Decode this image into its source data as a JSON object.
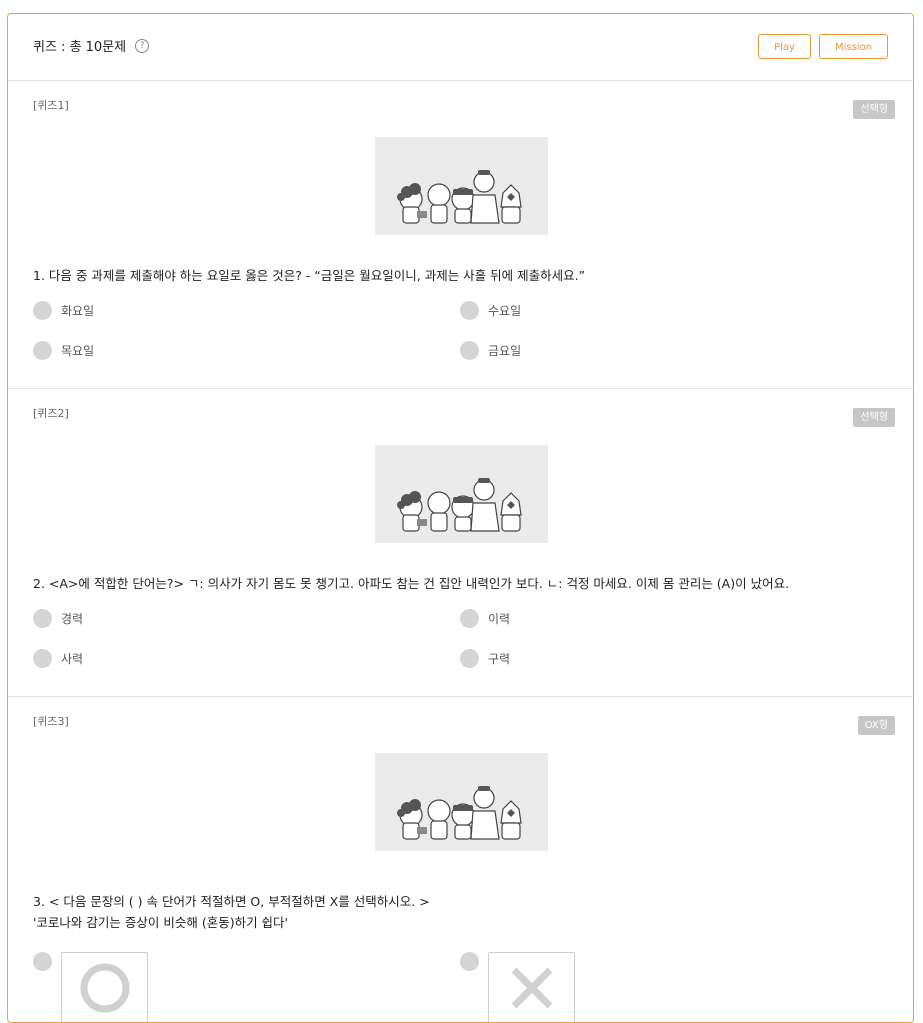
{
  "header": {
    "title": "퀴즈 : 총 10문제",
    "help_icon": "question-circle-icon",
    "play_label": "Play",
    "mission_label": "Mission",
    "accent_color": "#e8963a"
  },
  "quizzes": [
    {
      "label": "[퀴즈1]",
      "type": "선택형",
      "image": "characters-illustration",
      "question": "1. 다음 중 과제를 제출해야 하는 요일로 옳은 것은? - “금일은 월요일이니, 과제는 사흘 뒤에 제출하세요.”",
      "options": [
        "화요일",
        "수요일",
        "목요일",
        "금요일"
      ]
    },
    {
      "label": "[퀴즈2]",
      "type": "선택형",
      "image": "characters-illustration",
      "question": "2. <A>에 적합한 단어는?> ㄱ: 의사가 자기 몸도 못 챙기고. 아파도 참는 건 집안 내력인가 보다. ㄴ: 걱정 마세요. 이제 몸 관리는 (A)이 났어요.",
      "options": [
        "경력",
        "이력",
        "사력",
        "구력"
      ]
    },
    {
      "label": "[퀴즈3]",
      "type": "OX형",
      "image": "characters-illustration",
      "question_line1": "3. < 다음 문장의 (  ) 속 단어가 적절하면 O, 부적절하면 X를 선택하시오. >",
      "question_line2": "'코로나와 감기는 증상이 비슷해 (혼동)하기 쉽다'",
      "options": [
        "O",
        "X"
      ]
    }
  ]
}
